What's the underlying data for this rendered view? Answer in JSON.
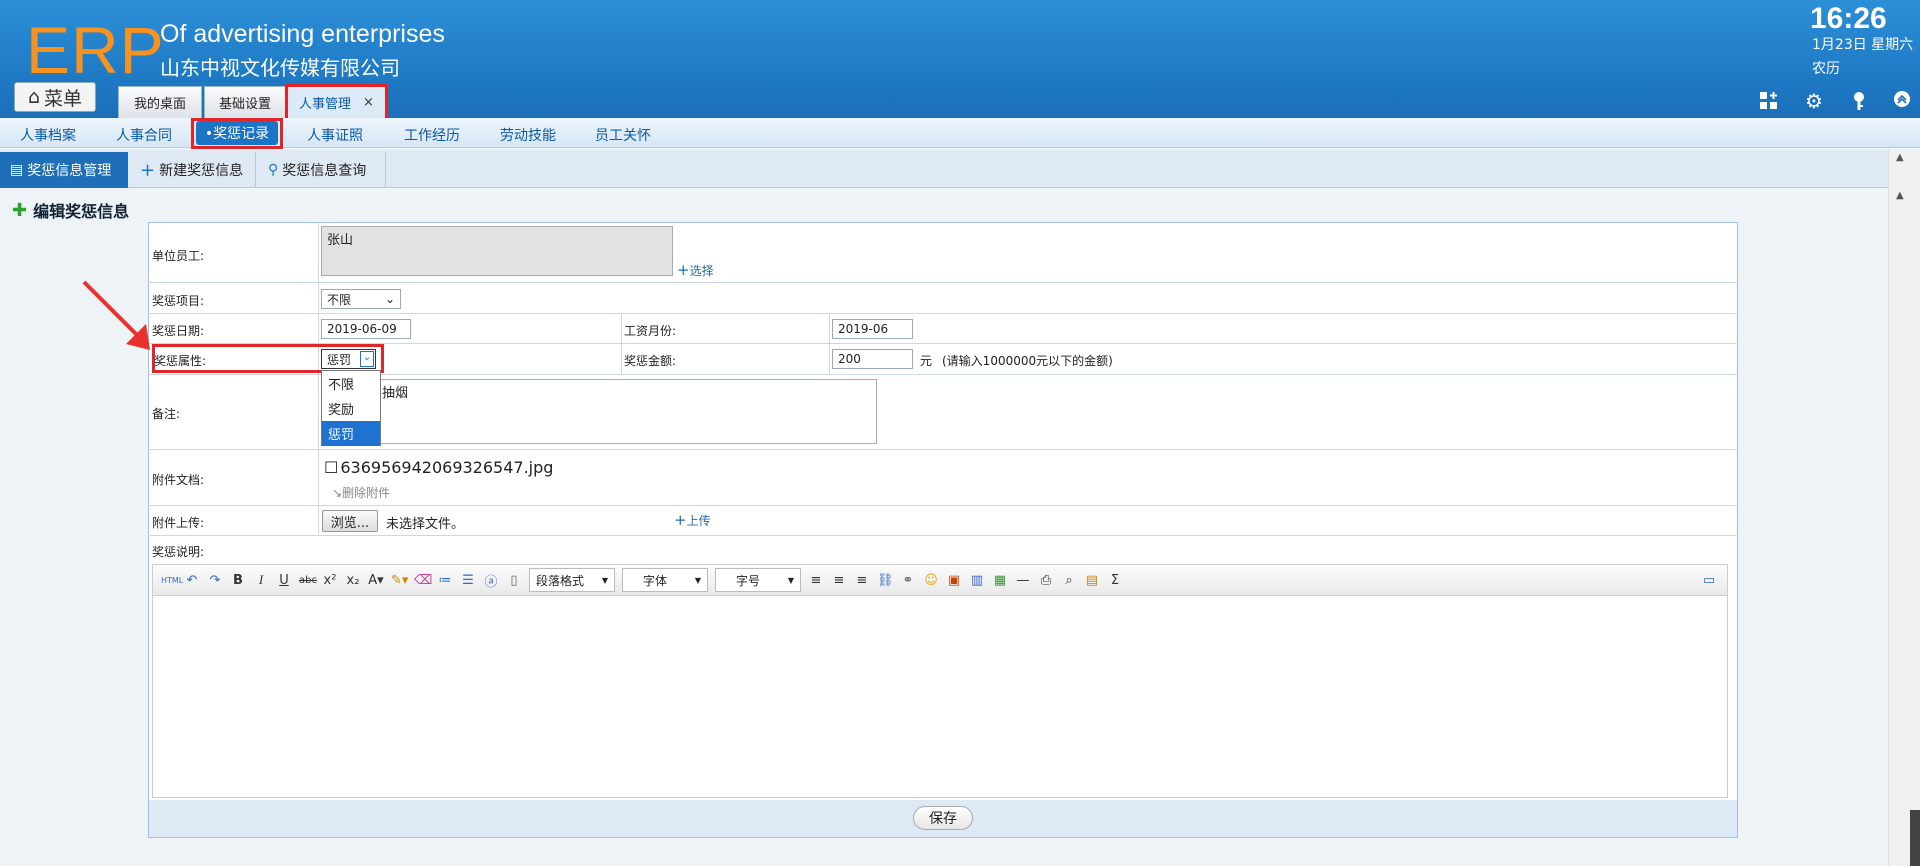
{
  "header": {
    "logo": "ERP",
    "title_en": "Of advertising enterprises",
    "title_cn": "山东中视文化传媒有限公司",
    "time": "16:26",
    "date": "1月23日 星期六",
    "lunar": "农历",
    "menu_label": "菜单"
  },
  "top_tabs": [
    {
      "label": "我的桌面"
    },
    {
      "label": "基础设置"
    },
    {
      "label": "人事管理",
      "close": "×"
    }
  ],
  "subnav": [
    {
      "label": "人事档案"
    },
    {
      "label": "人事合同"
    },
    {
      "label": "•奖惩记录"
    },
    {
      "label": "人事证照"
    },
    {
      "label": "工作经历"
    },
    {
      "label": "劳动技能"
    },
    {
      "label": "员工关怀"
    }
  ],
  "module_tabs": [
    {
      "label": "奖惩信息管理"
    },
    {
      "label": "新建奖惩信息"
    },
    {
      "label": "奖惩信息查询"
    }
  ],
  "page_title": "编辑奖惩信息",
  "form": {
    "employee": {
      "label": "单位员工:",
      "value": "张山",
      "select_link": "选择"
    },
    "item": {
      "label": "奖惩项目:",
      "value": "不限"
    },
    "date": {
      "label": "奖惩日期:",
      "value": "2019-06-09"
    },
    "salary_month": {
      "label": "工资月份:",
      "value": "2019-06"
    },
    "attribute": {
      "label": "奖惩属性:",
      "value": "惩罚",
      "options": [
        "不限",
        "奖励",
        "惩罚"
      ]
    },
    "amount": {
      "label": "奖惩金额:",
      "value": "200",
      "unit": "元",
      "hint": "(请输入1000000元以下的金额)"
    },
    "remark": {
      "label": "备注:",
      "value": "抽烟"
    },
    "attachment": {
      "label": "附件文档:",
      "file": "636956942069326547.jpg",
      "delete": "删除附件"
    },
    "upload": {
      "label": "附件上传:",
      "browse": "浏览...",
      "status": "未选择文件。",
      "upload_link": "上传"
    },
    "description": {
      "label": "奖惩说明:"
    }
  },
  "editor": {
    "para_format": "段落格式",
    "font": "字体",
    "size": "字号"
  },
  "save_label": "保存"
}
